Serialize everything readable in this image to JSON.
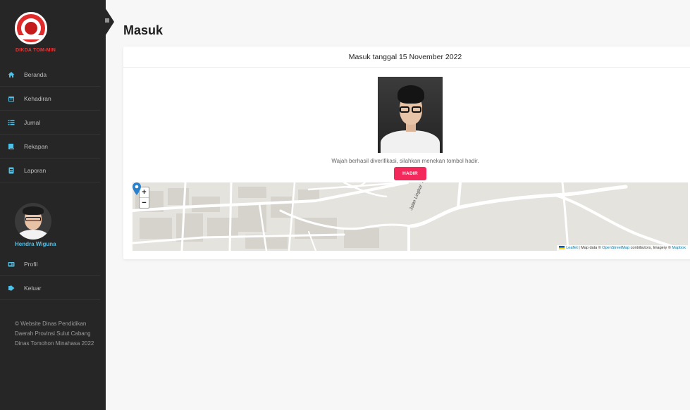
{
  "sidebar": {
    "logo_text": "DIKDA TOM-MIN",
    "menu": [
      {
        "label": "Beranda",
        "icon": "home-icon"
      },
      {
        "label": "Kehadiran",
        "icon": "calendar-icon"
      },
      {
        "label": "Jurnal",
        "icon": "list-icon"
      },
      {
        "label": "Rekapan",
        "icon": "book-icon"
      },
      {
        "label": "Laporan",
        "icon": "report-icon"
      }
    ],
    "user_name": "Hendra Wiguna",
    "menu2": [
      {
        "label": "Profil",
        "icon": "id-card-icon"
      },
      {
        "label": "Keluar",
        "icon": "sign-out-icon"
      }
    ],
    "footer": "© Website Dinas Pendidikan Daerah Provinsi Sulut Cabang Dinas Tomohon Minahasa 2022"
  },
  "main": {
    "title": "Masuk",
    "card_header": "Masuk tanggal 15 November 2022",
    "verify_text": "Wajah berhasil diverifikasi, silahkan menekan tombol hadir.",
    "hadir_label": "HADIR",
    "map": {
      "zoom_in": "+",
      "zoom_out": "−",
      "street_label": "Jalan Lingkar Timur",
      "attribution_leaflet": "Leaflet",
      "attribution_mid": " | Map data © ",
      "attribution_osm": "OpenStreetMap",
      "attribution_end": " contributors, Imagery © ",
      "attribution_mapbox": "Mapbox"
    }
  },
  "colors": {
    "sidebar_bg": "#262626",
    "accent_blue": "#4ec1e8",
    "button_red": "#f2295a"
  }
}
